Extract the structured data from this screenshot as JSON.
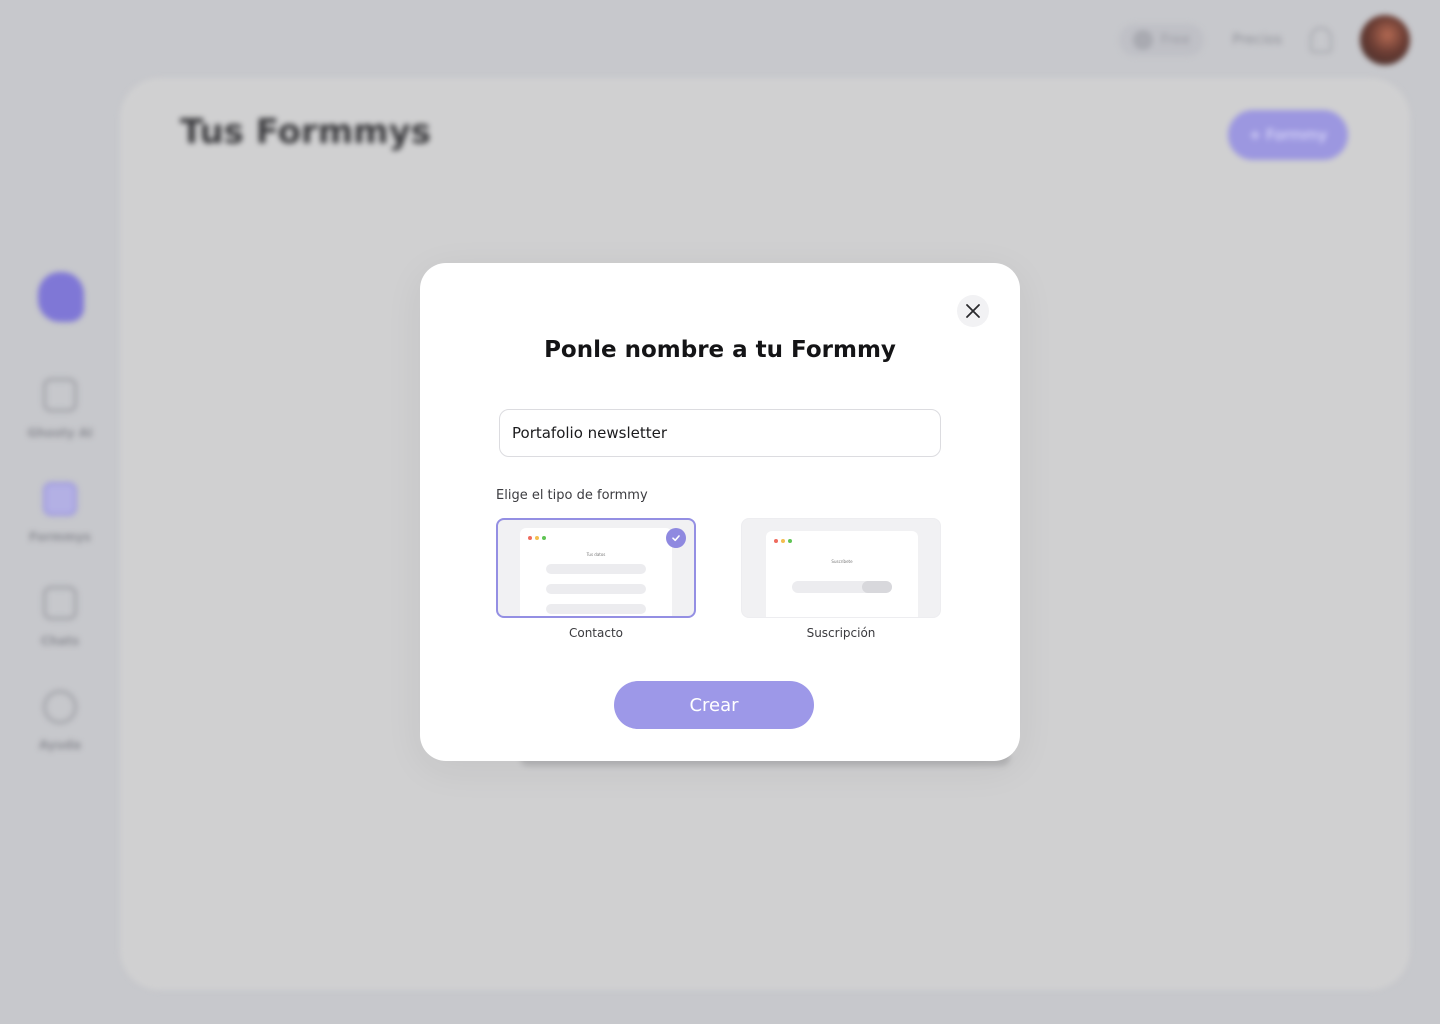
{
  "background": {
    "topbar": {
      "plan_label": "Free",
      "link_label": "Precios"
    },
    "main": {
      "title": "Tus Formmys",
      "new_button_label": "+ Formmy"
    },
    "sidebar": {
      "items": [
        {
          "label": "Ghosty AI",
          "icon": "chat-icon"
        },
        {
          "label": "Formmys",
          "icon": "forms-icon"
        },
        {
          "label": "Chats",
          "icon": "message-icon"
        },
        {
          "label": "Ayuda",
          "icon": "help-icon"
        }
      ]
    }
  },
  "modal": {
    "title": "Ponle nombre a tu Formmy",
    "name_input_value": "Portafolio newsletter",
    "type_label": "Elige el tipo de formmy",
    "options": [
      {
        "label": "Contacto",
        "preview_title": "Tus datos",
        "selected": true
      },
      {
        "label": "Suscripción",
        "preview_title": "Suscríbete",
        "selected": false
      }
    ],
    "create_button_label": "Crear"
  },
  "colors": {
    "accent": "#9d98e8",
    "selected_border": "#948fe3",
    "check_badge": "#8f89e0",
    "overlay_background": "#c7c8cc"
  }
}
